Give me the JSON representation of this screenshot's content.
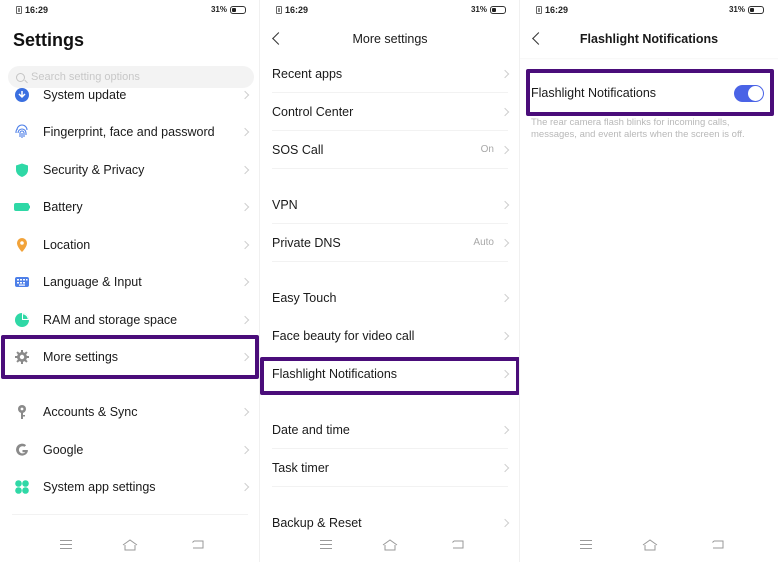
{
  "status_bar": {
    "time": "16:29",
    "battery_percent": "31%",
    "battery_level": 0.31
  },
  "panel1": {
    "title": "Settings",
    "search": {
      "placeholder": "Search setting options"
    },
    "items": [
      {
        "label": "System update",
        "icon": "system-update-icon",
        "color": "#3a6fe0"
      },
      {
        "label": "Fingerprint, face and password",
        "icon": "fingerprint-icon",
        "color": "#4d7fe8"
      },
      {
        "label": "Security & Privacy",
        "icon": "shield-icon",
        "color": "#2fd8a6"
      },
      {
        "label": "Battery",
        "icon": "battery-icon",
        "color": "#2fd8a6"
      },
      {
        "label": "Location",
        "icon": "location-pin-icon",
        "color": "#f2a33a"
      },
      {
        "label": "Language & Input",
        "icon": "keyboard-icon",
        "color": "#4d7fe8"
      },
      {
        "label": "RAM and storage space",
        "icon": "pie-chart-icon",
        "color": "#2fd8a6"
      },
      {
        "label": "More settings",
        "icon": "gear-icon",
        "color": "#8a8a8a",
        "highlighted": true
      },
      {
        "label": "Accounts & Sync",
        "icon": "key-icon",
        "color": "#8a8a8a"
      },
      {
        "label": "Google",
        "icon": "google-icon",
        "color": "#8a8a8a"
      },
      {
        "label": "System app settings",
        "icon": "apps-grid-icon",
        "color": "#2fd8a6"
      }
    ]
  },
  "panel2": {
    "title": "More settings",
    "items": [
      {
        "label": "Recent apps",
        "value": ""
      },
      {
        "label": "Control Center",
        "value": ""
      },
      {
        "label": "SOS Call",
        "value": "On"
      },
      {
        "label": "VPN",
        "value": ""
      },
      {
        "label": "Private DNS",
        "value": "Auto"
      },
      {
        "label": "Easy Touch",
        "value": ""
      },
      {
        "label": "Face beauty for video call",
        "value": ""
      },
      {
        "label": "Flashlight Notifications",
        "value": "",
        "highlighted": true
      },
      {
        "label": "Date and time",
        "value": ""
      },
      {
        "label": "Task timer",
        "value": ""
      },
      {
        "label": "Backup & Reset",
        "value": ""
      }
    ]
  },
  "panel3": {
    "title": "Flashlight Notifications",
    "toggle": {
      "label": "Flashlight Notifications",
      "enabled": true
    },
    "description": "The rear camera flash blinks for incoming calls, messages, and event alerts when the screen is off."
  },
  "nav": {
    "menu": "menu-icon",
    "home": "home-icon",
    "back": "back-icon"
  },
  "colors": {
    "highlight": "#4a0d7a",
    "toggle_on": "#4a63e6"
  }
}
